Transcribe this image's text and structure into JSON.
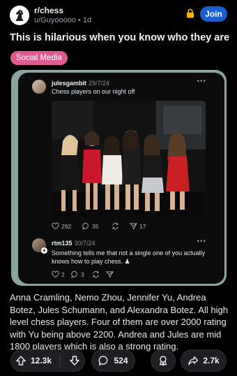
{
  "subreddit": {
    "name": "r/chess",
    "meta": "u/Guyooooo • 1d",
    "join_label": "Join"
  },
  "post": {
    "title": "This is hilarious when you know who they are",
    "flair": "Social Media",
    "body": "Anna Cramling, Nemo Zhou, Jennifer Yu, Andrea Botez, Jules Schumann, and Alexandra Botez. All high level chess players. Four of them are over 2000 rating with Yu being above 2200. Andrea and Jules are mid 1800 players which is also a strong rating."
  },
  "embed": {
    "tweet": {
      "user": "julesgambit",
      "date": "29/7/24",
      "text": "Chess players on our night off",
      "likes": "292",
      "comments": "35",
      "shares": "17"
    },
    "reply": {
      "user": "rtm135",
      "date": "30/7/24",
      "text": "Something tells me that not a single one of you actually knows how to play chess. ♟",
      "likes": "2",
      "comments": "3"
    }
  },
  "actions": {
    "upvotes": "12.3k",
    "comments": "524",
    "shares": "2.7k"
  },
  "icons": [
    "chess-knight-avatar-icon",
    "lock-icon",
    "heart-icon",
    "comment-icon",
    "repost-icon",
    "send-icon",
    "upvote-icon",
    "downvote-icon",
    "comment-bubble-icon",
    "award-icon",
    "share-icon"
  ]
}
